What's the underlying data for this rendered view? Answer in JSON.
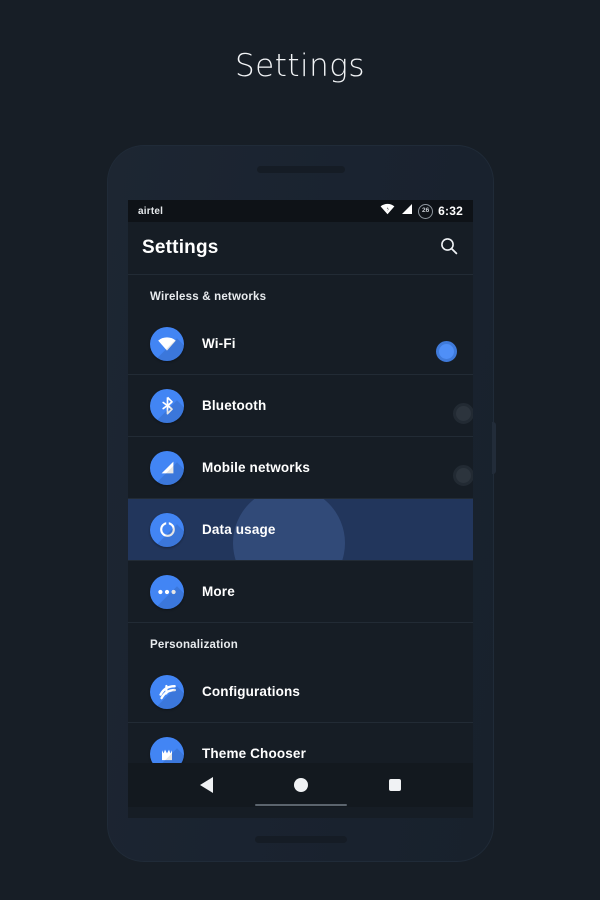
{
  "page": {
    "title": "Settings",
    "background_color": "#171e26"
  },
  "phone": {
    "frame_color": "#1b2430",
    "screen_background": "#161d25"
  },
  "statusbar": {
    "carrier": "airtel",
    "clock": "6:32",
    "battery_level": "26",
    "icons": [
      "wifi-icon",
      "cellular-signal-icon",
      "battery-circle-icon"
    ]
  },
  "appbar": {
    "title": "Settings",
    "search_icon": "search-icon"
  },
  "accent_color": "#4285f4",
  "selected_row_color": "#22365c",
  "sections": [
    {
      "header": "Wireless & networks",
      "items": [
        {
          "label": "Wi-Fi",
          "icon": "wifi-icon",
          "control": "toggle",
          "toggle_state": "on",
          "selected": false
        },
        {
          "label": "Bluetooth",
          "icon": "bluetooth-icon",
          "control": "toggle",
          "toggle_state": "off",
          "selected": false
        },
        {
          "label": "Mobile networks",
          "icon": "mobile-network-icon",
          "control": "toggle",
          "toggle_state": "off",
          "selected": false
        },
        {
          "label": "Data usage",
          "icon": "data-usage-icon",
          "control": "none",
          "toggle_state": "",
          "selected": true
        },
        {
          "label": "More",
          "icon": "more-dots-icon",
          "control": "none",
          "toggle_state": "",
          "selected": false
        }
      ]
    },
    {
      "header": "Personalization",
      "items": [
        {
          "label": "Configurations",
          "icon": "configurations-icon",
          "control": "none",
          "toggle_state": "",
          "selected": false
        },
        {
          "label": "Theme Chooser",
          "icon": "theme-chooser-icon",
          "control": "none",
          "toggle_state": "",
          "selected": false
        }
      ]
    }
  ],
  "navbar": {
    "back": "back-triangle-icon",
    "home": "home-circle-icon",
    "recents": "recents-square-icon"
  }
}
